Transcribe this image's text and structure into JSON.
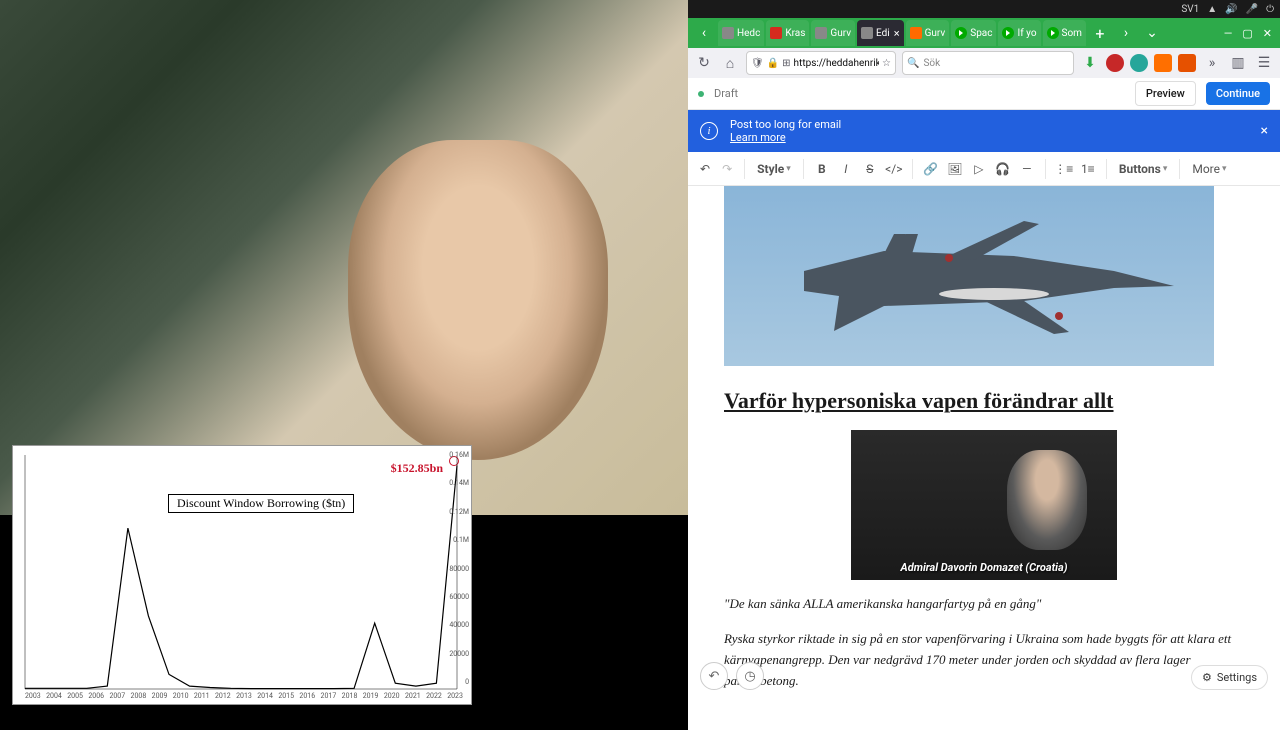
{
  "sysbar": {
    "lang": "SV1"
  },
  "tabs": {
    "items": [
      {
        "label": "Hedc"
      },
      {
        "label": "Kras"
      },
      {
        "label": "Gurv"
      },
      {
        "label": "Edi",
        "active": true
      },
      {
        "label": "Gurv"
      },
      {
        "label": "Spac"
      },
      {
        "label": "If yo"
      },
      {
        "label": "Som"
      }
    ]
  },
  "urlbar": {
    "url": "https://heddahenrik.subst"
  },
  "searchbar": {
    "placeholder": "Sök"
  },
  "editor": {
    "draft": "Draft",
    "preview": "Preview",
    "continue": "Continue"
  },
  "banner": {
    "text": "Post too long for email",
    "link": "Learn more"
  },
  "format_toolbar": {
    "style": "Style",
    "buttons": "Buttons",
    "more": "More"
  },
  "article": {
    "heading": "Varför hypersoniska vapen förändrar allt",
    "admiral_caption": "Admiral Davorin Domazet (Croatia)",
    "quote": "\"De kan sänka ALLA amerikanska hangarfartyg på en gång\"",
    "body": "Ryska styrkor riktade in sig på en stor vapenförvaring i Ukraina som hade byggts för att klara ett kärnvapenangrepp. Den var nedgrävd 170 meter under jorden och skyddad av flera lager pansarbetong."
  },
  "settings": {
    "label": "Settings"
  },
  "floats": {
    "undo": "↶",
    "clock": "◷"
  },
  "chart_data": {
    "type": "line",
    "title": "Discount Window Borrowing ($tn)",
    "peak_label": "$152.85bn",
    "xlabel": "",
    "ylabel": "",
    "categories": [
      "2003",
      "2004",
      "2005",
      "2006",
      "2007",
      "2008",
      "2009",
      "2010",
      "2011",
      "2012",
      "2013",
      "2014",
      "2015",
      "2016",
      "2017",
      "2018",
      "2019",
      "2020",
      "2021",
      "2022",
      "2023"
    ],
    "ytick_labels": [
      "0.16M",
      "0.14M",
      "0.12M",
      "0.1M",
      "80000",
      "60000",
      "40000",
      "20000",
      "0"
    ],
    "ylim": [
      0,
      160000
    ],
    "values": [
      500,
      500,
      500,
      500,
      2000,
      110000,
      50000,
      10000,
      2000,
      1000,
      500,
      300,
      300,
      300,
      300,
      300,
      500,
      45000,
      4000,
      2000,
      4000,
      152850
    ]
  }
}
